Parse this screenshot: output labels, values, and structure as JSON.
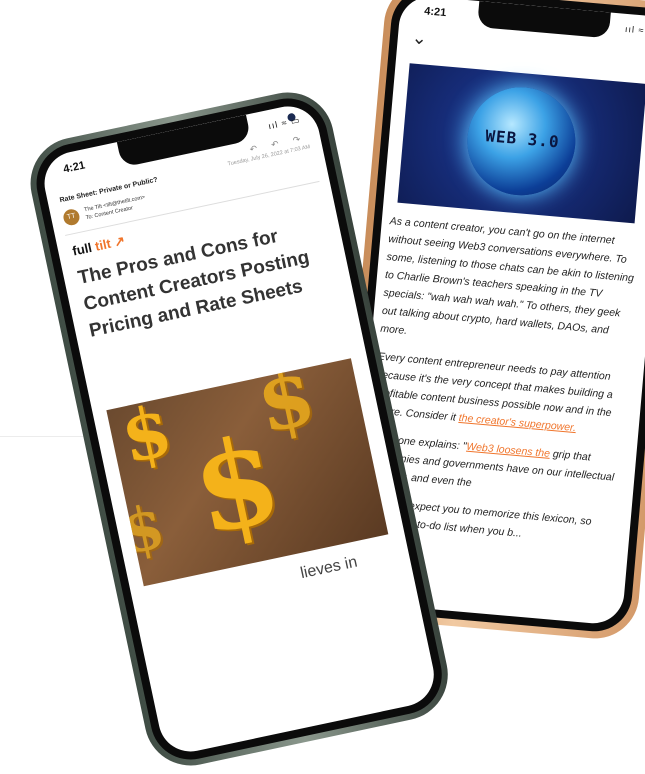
{
  "back_phone": {
    "time": "4:21",
    "status_icons": "ııl ≈ ▭",
    "back_icon": "chevron-down-icon",
    "menu_icon": "kebab-icon",
    "banner_text": "WEB 3.0",
    "paragraphs": [
      "As a content creator, you can't go on the internet without seeing Web3 conversations everywhere. To some, listening to those chats can be akin to listening to Charlie Brown's teachers speaking in the TV specials: \"wah wah wah wah.\" To others, they geek out talking about crypto, hard wallets, DAOs, and more.",
      "Every content entrepreneur needs to pay attention because it's the very concept that makes building a profitable content business possible now and in the future. Consider it"
    ],
    "link_creator": "the creator's superpower.",
    "p3_prefix": "Someone explains: \"",
    "link_web3": "Web3 loosens the",
    "p3_rest": "grip that companies and governments have on our intellectual property, and even the",
    "p4": "We don't expect you to memorize this lexicon, so maybe this to-do list when you b..."
  },
  "front_phone": {
    "time": "4:21",
    "status_icons": "ııl ≈ ▭",
    "mail_actions": "↶ ↶ ↷",
    "subject": "Rate Sheet: Private or Public?",
    "date": "Tuesday, July 26, 2022 at 7:03 AM",
    "avatar_initials": "TT",
    "from_line1": "The Tilt <tilt@thetilt.com>",
    "from_line2": "To: Content Creator",
    "brand_full": "full ",
    "brand_tilt": "tilt ↗",
    "headline": "The Pros and Cons for Content Creators Posting Pricing and Rate Sheets",
    "partial_text": "lieves in"
  }
}
